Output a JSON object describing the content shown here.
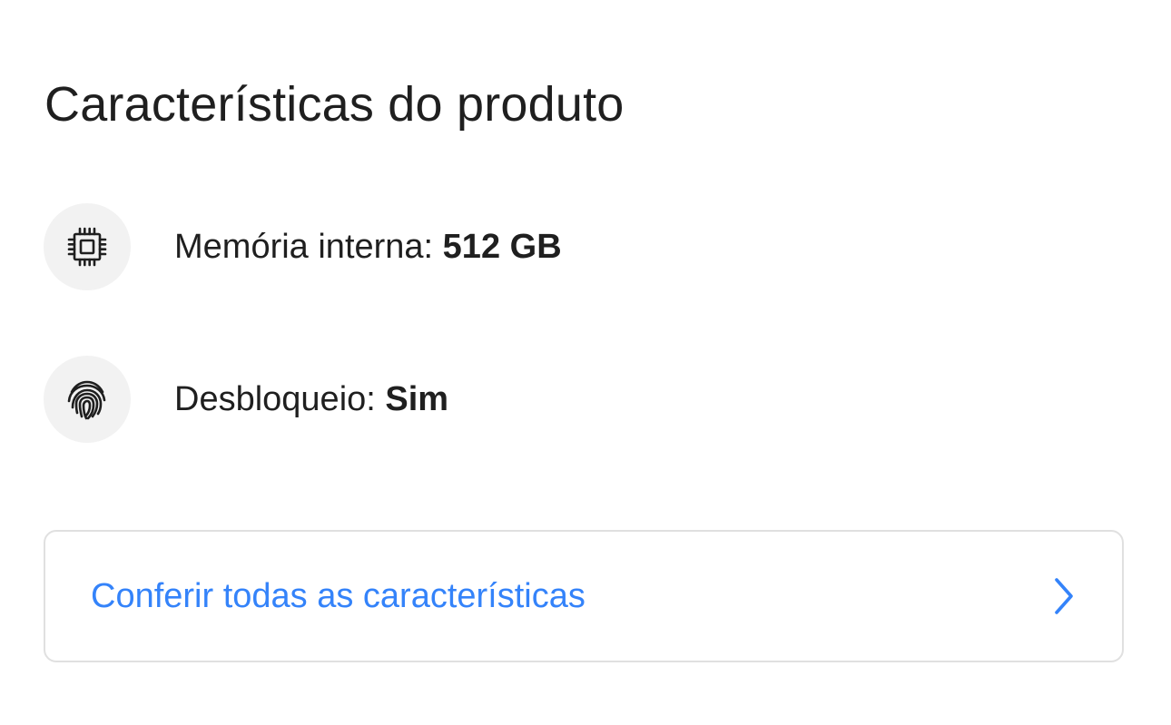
{
  "section": {
    "title": "Características do produto"
  },
  "features": [
    {
      "icon": "memory-chip-icon",
      "label": "Memória interna: ",
      "value": "512 GB"
    },
    {
      "icon": "fingerprint-icon",
      "label": "Desbloqueio: ",
      "value": "Sim"
    }
  ],
  "see_all": {
    "label": "Conferir todas as características",
    "icon": "chevron-right-icon"
  },
  "colors": {
    "accent": "#3483fa",
    "text": "#1f1f1f",
    "icon_background": "#f2f2f2",
    "border": "#e0e0e0"
  }
}
